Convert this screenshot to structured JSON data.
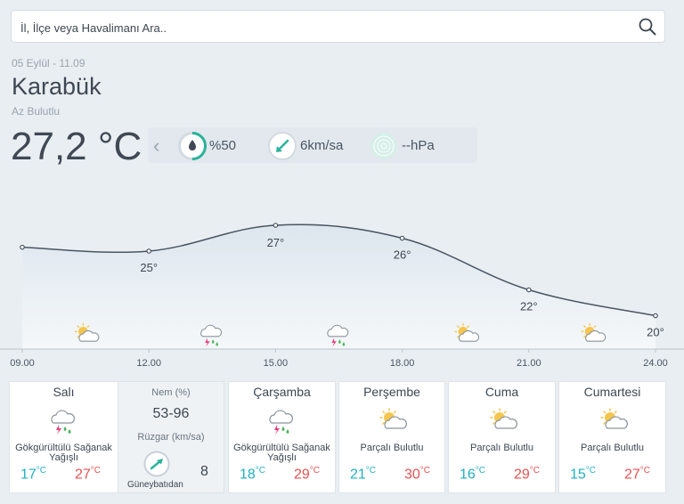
{
  "search": {
    "placeholder": "İl, İlçe veya Havalimanı Ara.."
  },
  "current": {
    "date_range": "05 Eylül - 11.09",
    "city": "Karabük",
    "condition": "Az Bulutlu",
    "temperature": "27,2 °C",
    "humidity": "%50",
    "humidity_value": 50,
    "wind_value": "6",
    "wind_unit": "km/sa",
    "pressure": "--hPa"
  },
  "chart_data": {
    "type": "area",
    "x": [
      "09.00",
      "12.00",
      "15.00",
      "18.00",
      "21.00",
      "24.00"
    ],
    "values": [
      25.3,
      25,
      27,
      26,
      22,
      20
    ],
    "point_labels": [
      "",
      "25°",
      "27°",
      "26°",
      "22°",
      "20°"
    ],
    "icons": [
      "partly-cloudy-icon",
      "thunderstorm-icon",
      "thunderstorm-icon",
      "partly-cloudy-icon",
      "partly-cloudy-icon"
    ]
  },
  "today": {
    "day": "Salı",
    "condition": "Gökgürültülü Sağanak Yağışlı",
    "icon": "thunderstorm-icon",
    "low": "17",
    "high": "27",
    "humidity_label": "Nem (%)",
    "humidity_range": "53-96",
    "wind_label": "Rüzgar (km/sa)",
    "wind_direction": "Güneybatıdan",
    "wind_speed": "8"
  },
  "forecast": [
    {
      "day": "Çarşamba",
      "condition": "Gökgürültülü Sağanak Yağışlı",
      "icon": "thunderstorm-icon",
      "low": "18",
      "high": "29"
    },
    {
      "day": "Perşembe",
      "condition": "Parçalı Bulutlu",
      "icon": "partly-cloudy-icon",
      "low": "21",
      "high": "30"
    },
    {
      "day": "Cuma",
      "condition": "Parçalı Bulutlu",
      "icon": "partly-cloudy-icon",
      "low": "16",
      "high": "29"
    },
    {
      "day": "Cumartesi",
      "condition": "Parçalı Bulutlu",
      "icon": "partly-cloudy-icon",
      "low": "15",
      "high": "27"
    }
  ],
  "units": {
    "celsius": "°C"
  },
  "colors": {
    "low": "#1fb0c4",
    "high": "#e8504f",
    "accent": "#2bb39a"
  }
}
